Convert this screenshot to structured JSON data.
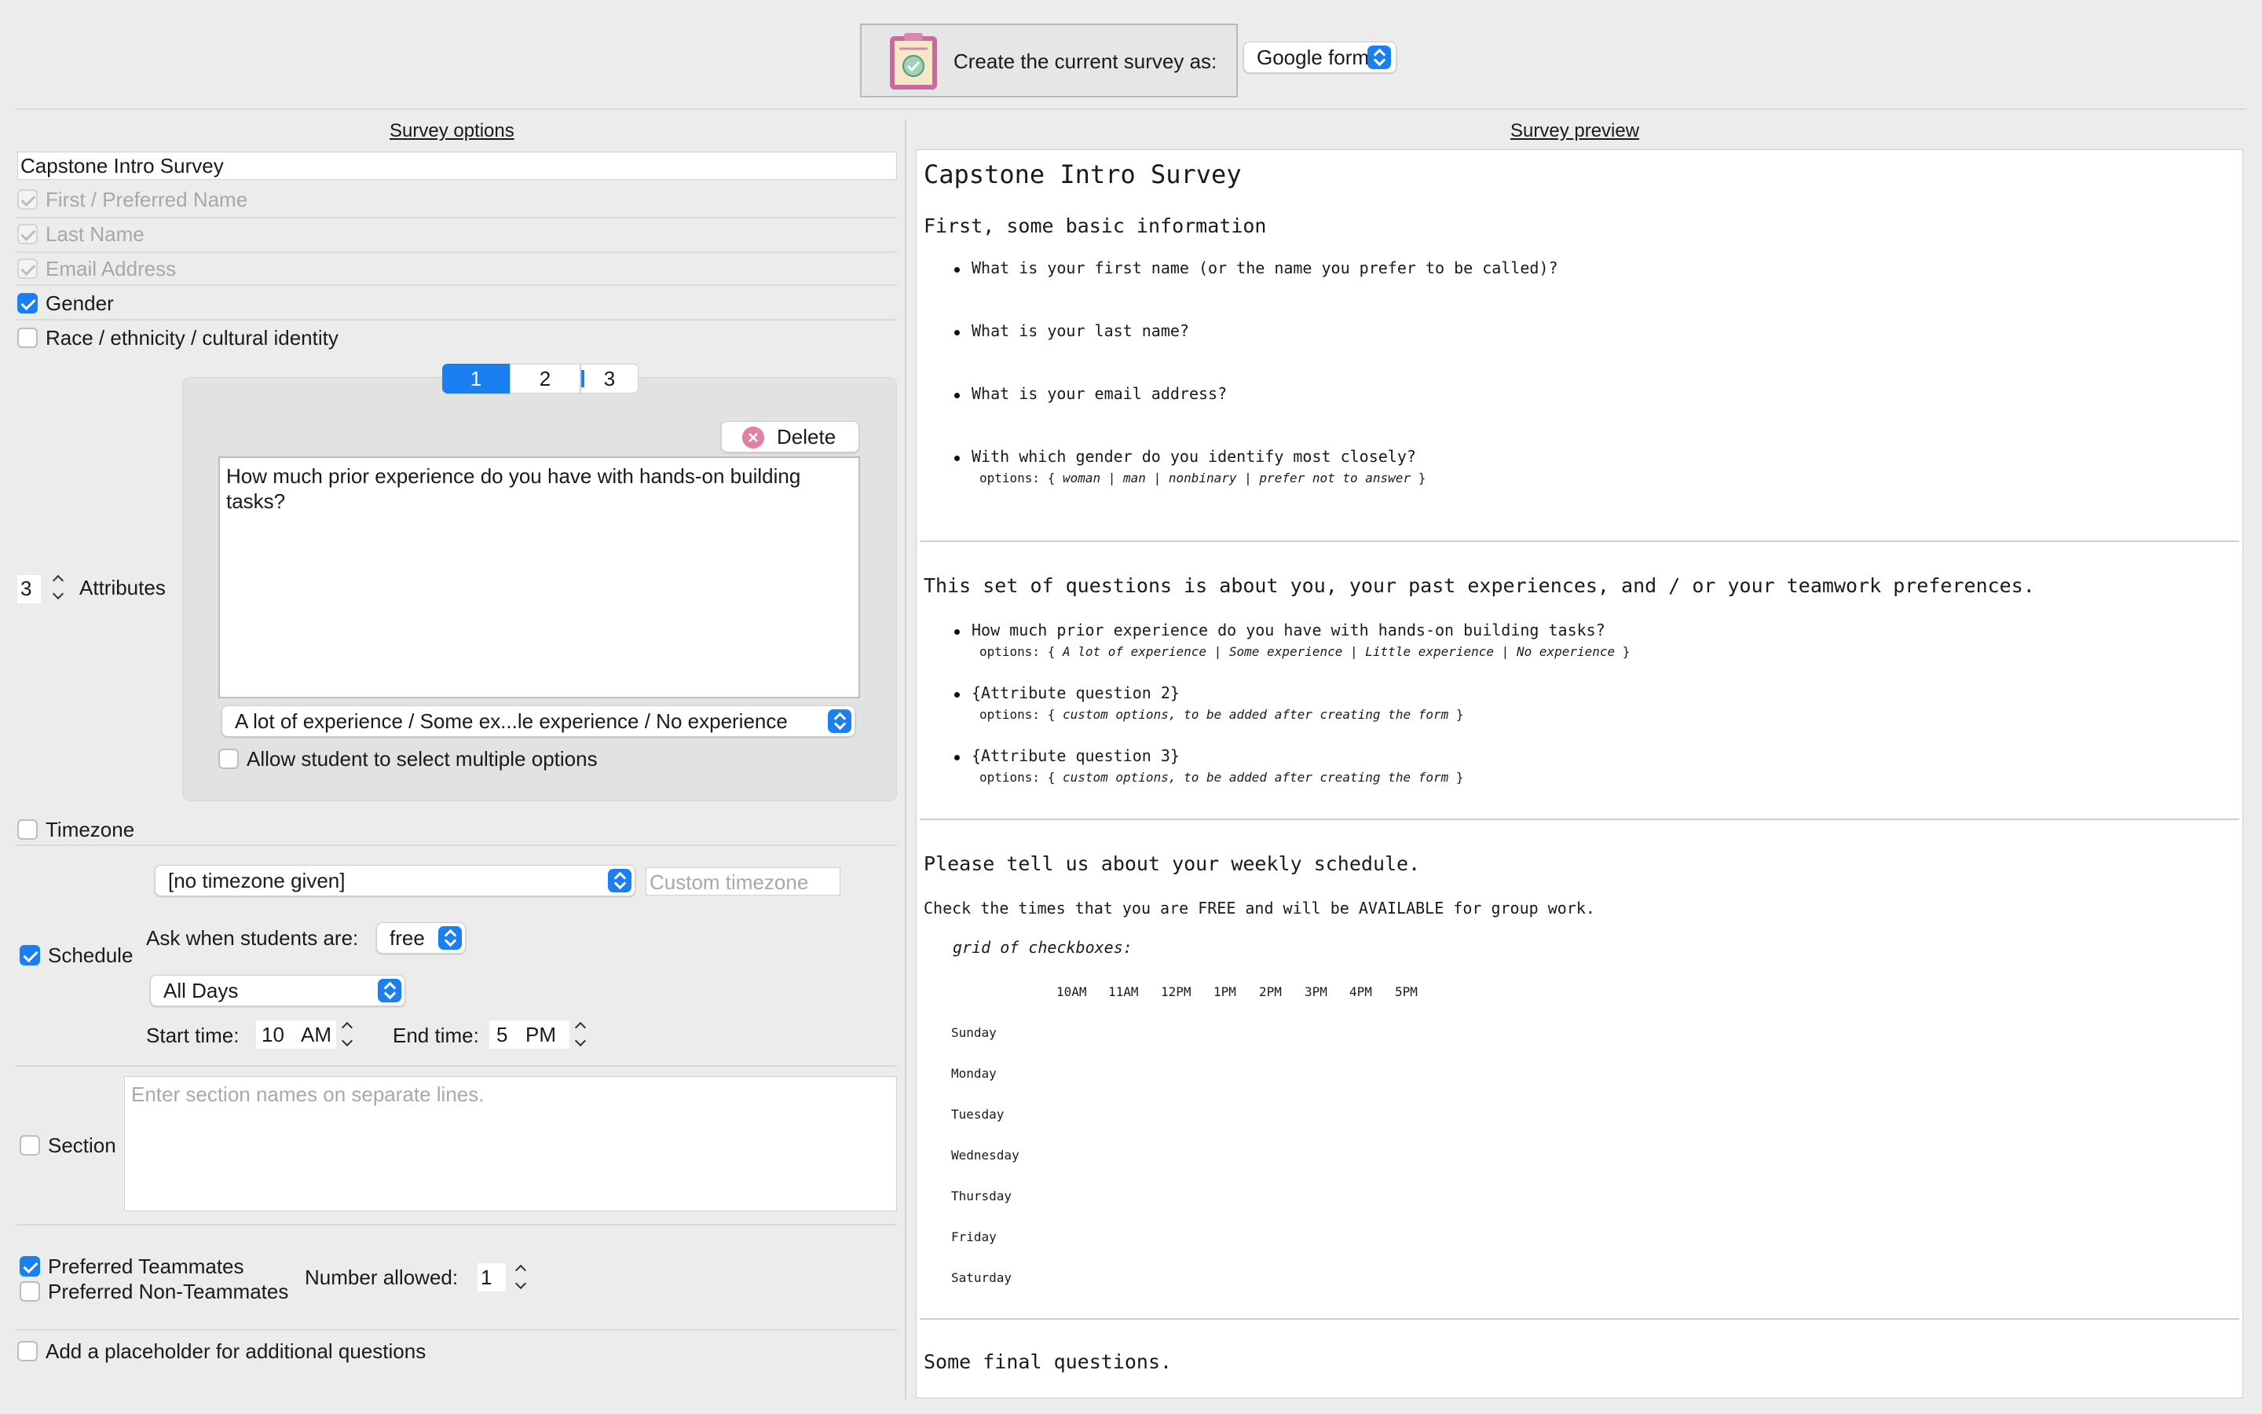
{
  "top": {
    "create_label": "Create the current survey as:",
    "format": "Google form"
  },
  "options": {
    "header": "Survey options",
    "title_value": "Capstone Intro Survey",
    "first_name": "First / Preferred Name",
    "last_name": "Last Name",
    "email": "Email Address",
    "gender": "Gender",
    "race": "Race / ethnicity / cultural identity",
    "attr_count": "3",
    "attr_label": "Attributes",
    "tabs": [
      "1",
      "2",
      "3"
    ],
    "delete": "Delete",
    "question": "How much prior experience do you have with hands-on building tasks?",
    "response_set": "A lot of experience / Some ex...le experience / No experience",
    "allow_multi": "Allow student to select multiple options",
    "timezone": "Timezone",
    "timezone_value": "[no timezone given]",
    "custom_timezone_placeholder": "Custom timezone",
    "schedule": "Schedule",
    "ask_when": "Ask when students are:",
    "free_value": "free",
    "days_value": "All Days",
    "start_label": "Start time:",
    "start_hour": "10",
    "start_ampm": "AM",
    "end_label": "End time:",
    "end_hour": "5",
    "end_ampm": "PM",
    "section": "Section",
    "section_placeholder": "Enter section names on separate lines.",
    "pref_teammates": "Preferred Teammates",
    "pref_non": "Preferred Non-Teammates",
    "number_allowed": "Number allowed:",
    "number_value": "1",
    "placeholder_q": "Add a placeholder for additional questions"
  },
  "preview": {
    "header": "Survey preview",
    "title": "Capstone Intro Survey",
    "basic_heading": "First, some basic information",
    "q_first": "What is your first name (or the name you prefer to be called)?",
    "q_last": "What is your last name?",
    "q_email": "What is your email address?",
    "q_gender": "With which gender do you identify most closely?",
    "gender_opts_pre": "options: { ",
    "gender_opts": "woman | man | nonbinary | prefer not to answer",
    "opts_post": " }",
    "attr_heading": "This set of questions is about you, your past experiences, and / or your teamwork preferences.",
    "attr_q1": "How much prior experience do you have with hands-on building tasks?",
    "attr_q1_opts": "A lot of experience | Some experience | Little experience | No experience",
    "attr_q2": "{Attribute question 2}",
    "attr_q3": "{Attribute question 3}",
    "custom_opts": "custom options, to be added after creating the form",
    "sched_heading": "Please tell us about your weekly schedule.",
    "sched_instr": "Check the times that you are FREE and will be AVAILABLE for group work.",
    "grid_label": "grid of checkboxes:",
    "times": [
      "10AM",
      "11AM",
      "12PM",
      "1PM",
      "2PM",
      "3PM",
      "4PM",
      "5PM"
    ],
    "days": [
      "Sunday",
      "Monday",
      "Tuesday",
      "Wednesday",
      "Thursday",
      "Friday",
      "Saturday"
    ],
    "final_heading": "Some final questions."
  }
}
